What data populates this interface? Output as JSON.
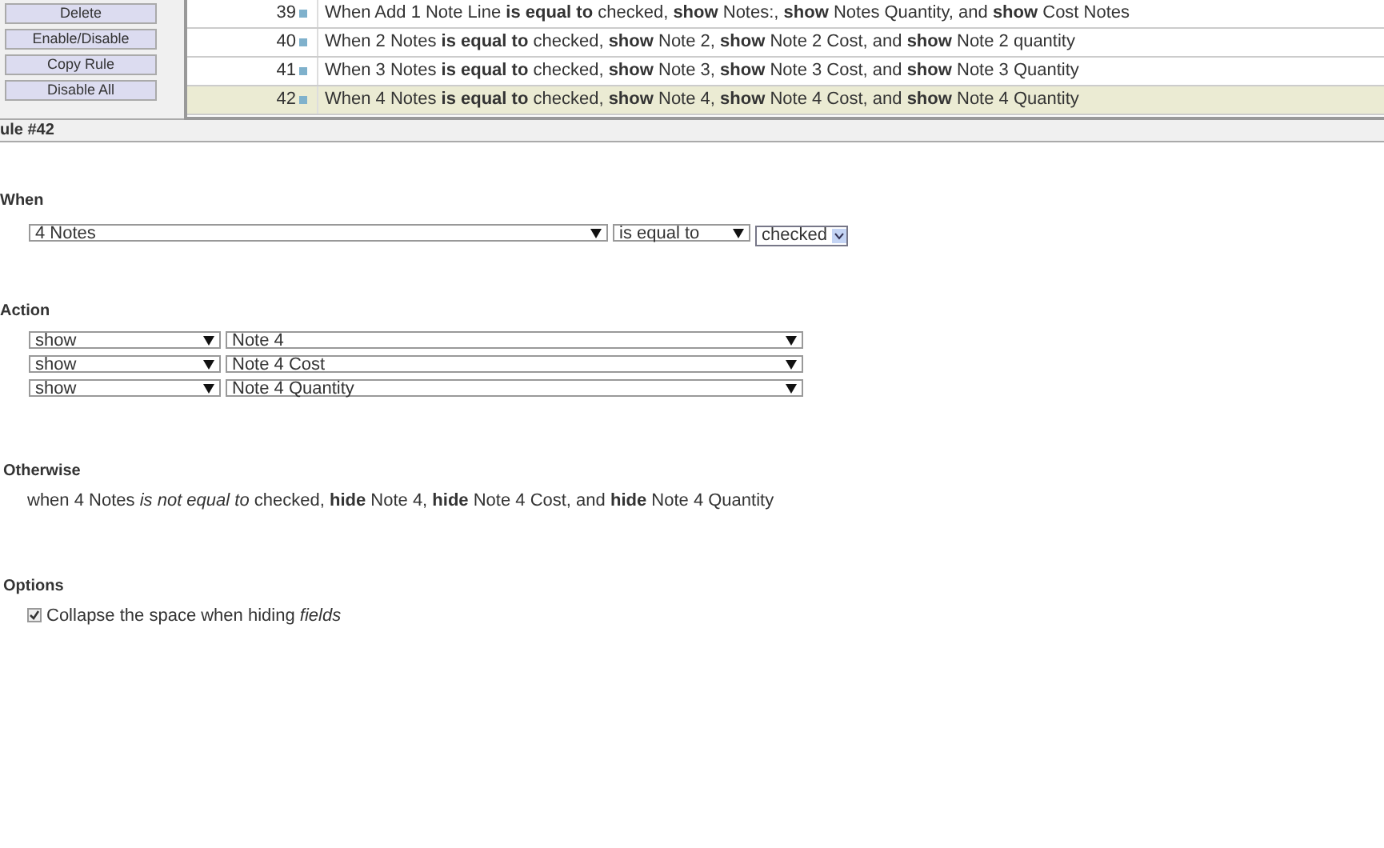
{
  "side_buttons": [
    "Delete",
    "Enable/Disable",
    "Copy Rule",
    "Disable All"
  ],
  "rules": [
    {
      "number": "39",
      "text": "When Add 1 Note Line **is equal to** checked, **show** Notes:, **show** Notes Quantity, and **show** Cost Notes",
      "selected": false
    },
    {
      "number": "40",
      "text": "When 2 Notes **is equal to** checked, **show** Note 2, **show** Note 2 Cost, and **show** Note 2 quantity",
      "selected": false
    },
    {
      "number": "41",
      "text": "When 3 Notes **is equal to** checked, **show** Note 3, **show** Note 3 Cost, and **show** Note 3 Quantity",
      "selected": false
    },
    {
      "number": "42",
      "text": "When 4 Notes **is equal to** checked, **show** Note 4, **show** Note 4 Cost, and **show** Note 4 Quantity",
      "selected": true
    }
  ],
  "rule_title": "ule #42",
  "when": {
    "heading": "When",
    "field": "4 Notes",
    "operator": "is equal to",
    "value": "checked"
  },
  "action": {
    "heading": "Action",
    "rows": [
      {
        "verb": "show",
        "target": "Note 4"
      },
      {
        "verb": "show",
        "target": "Note 4 Cost"
      },
      {
        "verb": "show",
        "target": "Note 4 Quantity"
      }
    ]
  },
  "otherwise": {
    "heading": "Otherwise",
    "text": "when 4 Notes *is not equal to* checked, **hide** Note 4, **hide** Note 4 Cost, and **hide** Note 4 Quantity"
  },
  "options": {
    "heading": "Options",
    "collapse": {
      "label": "Collapse the space when hiding *fields*",
      "checked": true
    }
  }
}
